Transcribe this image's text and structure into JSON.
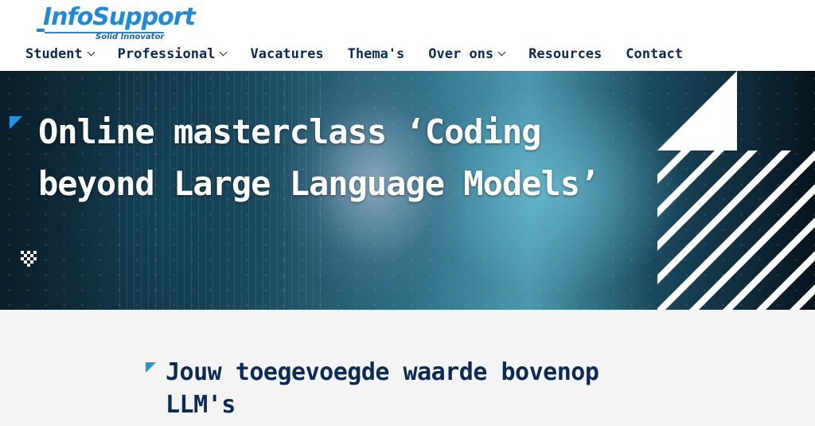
{
  "brand": {
    "logo_text": "InfoSupport",
    "tagline": "Solid Innovator",
    "primary_color": "#1f8ad6",
    "navy_color": "#0b2b55"
  },
  "nav": {
    "items": [
      {
        "label": "Student",
        "has_dropdown": true
      },
      {
        "label": "Professional",
        "has_dropdown": true
      },
      {
        "label": "Vacatures",
        "has_dropdown": false
      },
      {
        "label": "Thema's",
        "has_dropdown": false
      },
      {
        "label": "Over ons",
        "has_dropdown": true
      },
      {
        "label": "Resources",
        "has_dropdown": false
      },
      {
        "label": "Contact",
        "has_dropdown": false
      }
    ]
  },
  "hero": {
    "title": "Online masterclass ‘Coding beyond Large Language Models’",
    "image_icon": "ai-face-illustration"
  },
  "section": {
    "heading": "Jouw toegevoegde waarde bovenop LLM's"
  }
}
